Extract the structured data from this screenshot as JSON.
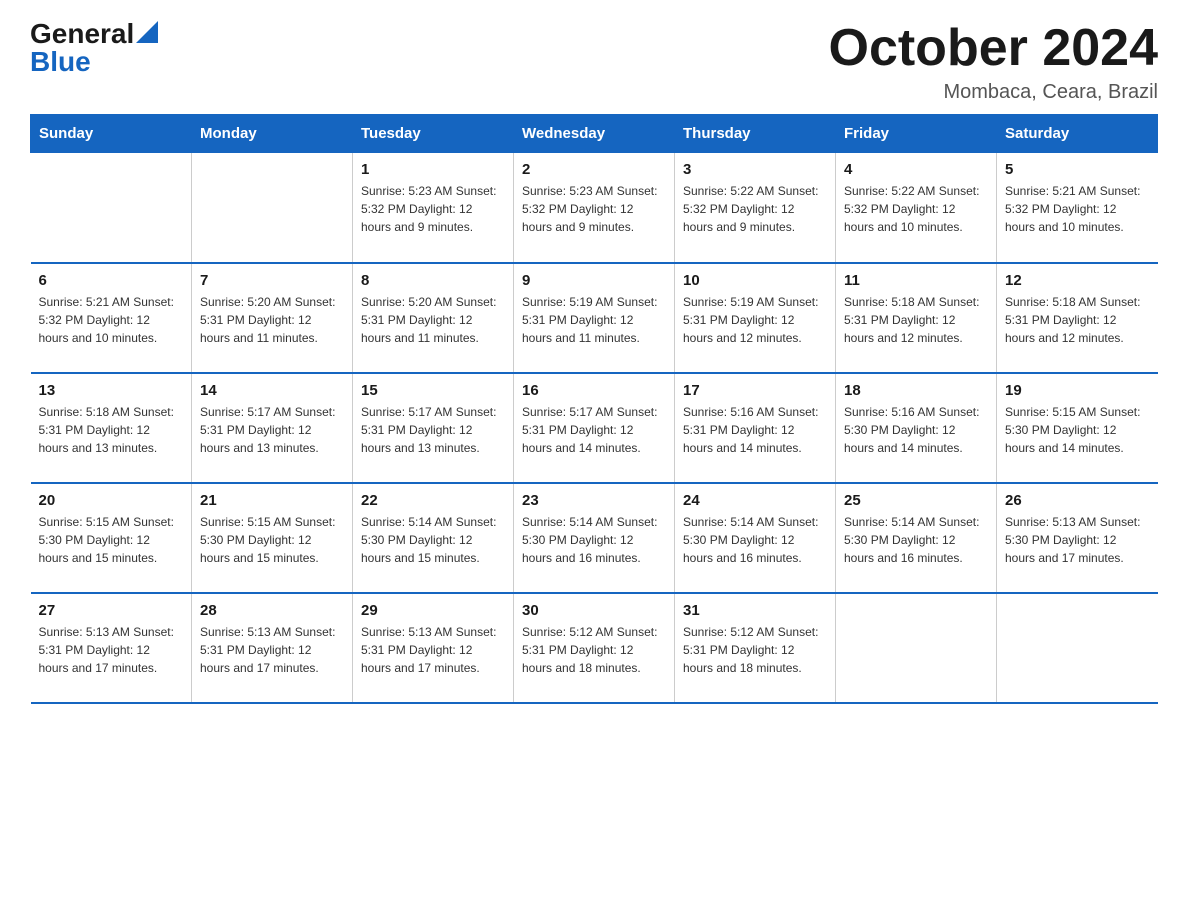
{
  "header": {
    "logo_general": "General",
    "logo_blue": "Blue",
    "month_title": "October 2024",
    "location": "Mombaca, Ceara, Brazil"
  },
  "days_of_week": [
    "Sunday",
    "Monday",
    "Tuesday",
    "Wednesday",
    "Thursday",
    "Friday",
    "Saturday"
  ],
  "weeks": [
    [
      {
        "day": "",
        "info": ""
      },
      {
        "day": "",
        "info": ""
      },
      {
        "day": "1",
        "info": "Sunrise: 5:23 AM\nSunset: 5:32 PM\nDaylight: 12 hours\nand 9 minutes."
      },
      {
        "day": "2",
        "info": "Sunrise: 5:23 AM\nSunset: 5:32 PM\nDaylight: 12 hours\nand 9 minutes."
      },
      {
        "day": "3",
        "info": "Sunrise: 5:22 AM\nSunset: 5:32 PM\nDaylight: 12 hours\nand 9 minutes."
      },
      {
        "day": "4",
        "info": "Sunrise: 5:22 AM\nSunset: 5:32 PM\nDaylight: 12 hours\nand 10 minutes."
      },
      {
        "day": "5",
        "info": "Sunrise: 5:21 AM\nSunset: 5:32 PM\nDaylight: 12 hours\nand 10 minutes."
      }
    ],
    [
      {
        "day": "6",
        "info": "Sunrise: 5:21 AM\nSunset: 5:32 PM\nDaylight: 12 hours\nand 10 minutes."
      },
      {
        "day": "7",
        "info": "Sunrise: 5:20 AM\nSunset: 5:31 PM\nDaylight: 12 hours\nand 11 minutes."
      },
      {
        "day": "8",
        "info": "Sunrise: 5:20 AM\nSunset: 5:31 PM\nDaylight: 12 hours\nand 11 minutes."
      },
      {
        "day": "9",
        "info": "Sunrise: 5:19 AM\nSunset: 5:31 PM\nDaylight: 12 hours\nand 11 minutes."
      },
      {
        "day": "10",
        "info": "Sunrise: 5:19 AM\nSunset: 5:31 PM\nDaylight: 12 hours\nand 12 minutes."
      },
      {
        "day": "11",
        "info": "Sunrise: 5:18 AM\nSunset: 5:31 PM\nDaylight: 12 hours\nand 12 minutes."
      },
      {
        "day": "12",
        "info": "Sunrise: 5:18 AM\nSunset: 5:31 PM\nDaylight: 12 hours\nand 12 minutes."
      }
    ],
    [
      {
        "day": "13",
        "info": "Sunrise: 5:18 AM\nSunset: 5:31 PM\nDaylight: 12 hours\nand 13 minutes."
      },
      {
        "day": "14",
        "info": "Sunrise: 5:17 AM\nSunset: 5:31 PM\nDaylight: 12 hours\nand 13 minutes."
      },
      {
        "day": "15",
        "info": "Sunrise: 5:17 AM\nSunset: 5:31 PM\nDaylight: 12 hours\nand 13 minutes."
      },
      {
        "day": "16",
        "info": "Sunrise: 5:17 AM\nSunset: 5:31 PM\nDaylight: 12 hours\nand 14 minutes."
      },
      {
        "day": "17",
        "info": "Sunrise: 5:16 AM\nSunset: 5:31 PM\nDaylight: 12 hours\nand 14 minutes."
      },
      {
        "day": "18",
        "info": "Sunrise: 5:16 AM\nSunset: 5:30 PM\nDaylight: 12 hours\nand 14 minutes."
      },
      {
        "day": "19",
        "info": "Sunrise: 5:15 AM\nSunset: 5:30 PM\nDaylight: 12 hours\nand 14 minutes."
      }
    ],
    [
      {
        "day": "20",
        "info": "Sunrise: 5:15 AM\nSunset: 5:30 PM\nDaylight: 12 hours\nand 15 minutes."
      },
      {
        "day": "21",
        "info": "Sunrise: 5:15 AM\nSunset: 5:30 PM\nDaylight: 12 hours\nand 15 minutes."
      },
      {
        "day": "22",
        "info": "Sunrise: 5:14 AM\nSunset: 5:30 PM\nDaylight: 12 hours\nand 15 minutes."
      },
      {
        "day": "23",
        "info": "Sunrise: 5:14 AM\nSunset: 5:30 PM\nDaylight: 12 hours\nand 16 minutes."
      },
      {
        "day": "24",
        "info": "Sunrise: 5:14 AM\nSunset: 5:30 PM\nDaylight: 12 hours\nand 16 minutes."
      },
      {
        "day": "25",
        "info": "Sunrise: 5:14 AM\nSunset: 5:30 PM\nDaylight: 12 hours\nand 16 minutes."
      },
      {
        "day": "26",
        "info": "Sunrise: 5:13 AM\nSunset: 5:30 PM\nDaylight: 12 hours\nand 17 minutes."
      }
    ],
    [
      {
        "day": "27",
        "info": "Sunrise: 5:13 AM\nSunset: 5:31 PM\nDaylight: 12 hours\nand 17 minutes."
      },
      {
        "day": "28",
        "info": "Sunrise: 5:13 AM\nSunset: 5:31 PM\nDaylight: 12 hours\nand 17 minutes."
      },
      {
        "day": "29",
        "info": "Sunrise: 5:13 AM\nSunset: 5:31 PM\nDaylight: 12 hours\nand 17 minutes."
      },
      {
        "day": "30",
        "info": "Sunrise: 5:12 AM\nSunset: 5:31 PM\nDaylight: 12 hours\nand 18 minutes."
      },
      {
        "day": "31",
        "info": "Sunrise: 5:12 AM\nSunset: 5:31 PM\nDaylight: 12 hours\nand 18 minutes."
      },
      {
        "day": "",
        "info": ""
      },
      {
        "day": "",
        "info": ""
      }
    ]
  ]
}
